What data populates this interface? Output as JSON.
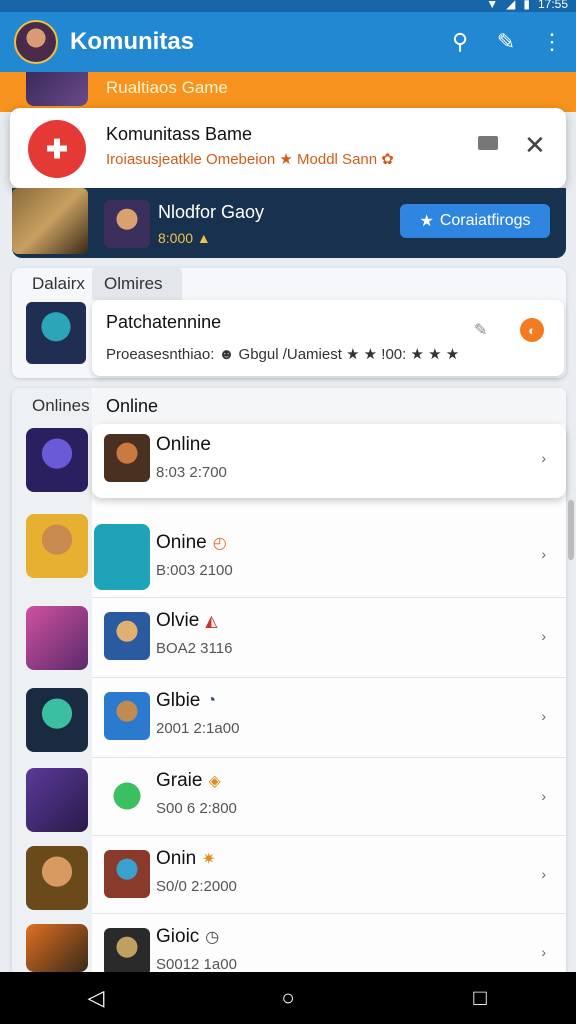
{
  "status": {
    "icons": [
      "▼",
      "◢",
      "▮",
      "17:55"
    ]
  },
  "appbar": {
    "title": "Komunitas",
    "actions": {
      "search": "⚲",
      "edit": "✎",
      "more": "⋮"
    }
  },
  "banner": {
    "label": "Rualtiaos Game"
  },
  "notification": {
    "title": "Komunitass Bame",
    "subtitle": "Iroiasusjeatkle Omebeion ★ Moddl Sann ✿",
    "icon_glyph": "✚",
    "close": "✕"
  },
  "featured": {
    "title": "Nlodfor Gaoy",
    "meta": "8:000 ▲",
    "button_label": "Coraiatfirogs",
    "button_icon": "★"
  },
  "card2": {
    "left_label": "Dalairx",
    "tab_label": "Olmires",
    "title": "Patchatennine",
    "subtitle": "Proeasesnthiao: ☻ Gbgul /Uamiest ★ ★ !00: ★ ★ ★",
    "edit_icon": "✎",
    "badge": "◐"
  },
  "list": {
    "left_label": "Onlines",
    "header": "Online",
    "rows": [
      {
        "title": "Online",
        "status": "",
        "sub": "8:03 2:700",
        "chevron": "›"
      },
      {
        "title": "Onine",
        "status": "◴",
        "sub": "B:003 2100",
        "chevron": "›"
      },
      {
        "title": "Olvie",
        "status": "◭",
        "sub": "BOA2 3116",
        "chevron": "›"
      },
      {
        "title": "Glbie",
        "status": "◔",
        "sub": "2001 2:1a00",
        "chevron": "›"
      },
      {
        "title": "Graie",
        "status": "◈",
        "sub": "S00 6 2:800",
        "chevron": "›"
      },
      {
        "title": "Onin",
        "status": "✷",
        "sub": "S0/0 2:2000",
        "chevron": "›"
      },
      {
        "title": "Gioic",
        "status": "◷",
        "sub": "S0012 1a00",
        "chevron": "›"
      }
    ]
  },
  "navbar": {
    "back": "◁",
    "home": "○",
    "recents": "□"
  },
  "colors": {
    "appbar": "#2388d2",
    "accent_orange": "#f7931e",
    "featured_bg": "#17314e",
    "button_blue": "#2f86e0"
  }
}
